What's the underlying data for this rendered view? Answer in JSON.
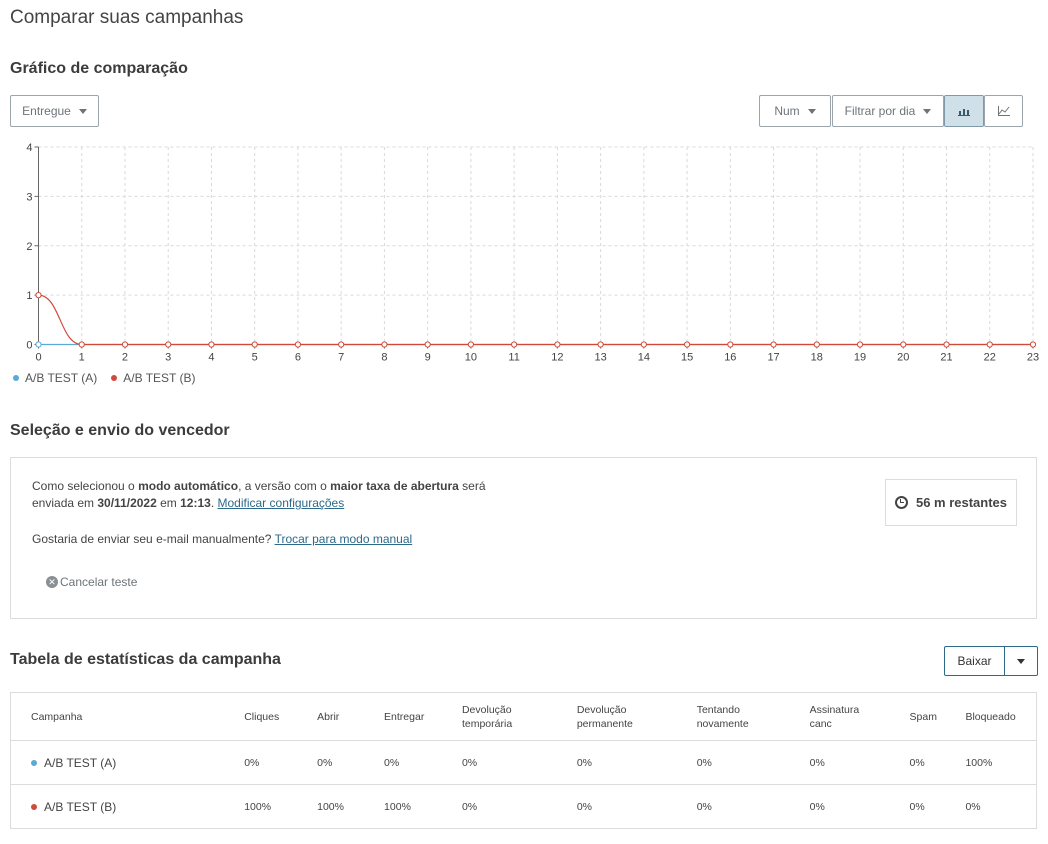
{
  "page": {
    "title": "Comparar suas campanhas"
  },
  "chart_section": {
    "title": "Gráfico de comparação",
    "metric_dropdown": "Entregue",
    "num_dropdown": "Num",
    "filter_dropdown": "Filtrar por dia",
    "view_buttons": [
      {
        "icon": "bar-chart-icon",
        "active": true
      },
      {
        "icon": "line-chart-icon",
        "active": false
      }
    ]
  },
  "chart_data": {
    "type": "line",
    "x": [
      0,
      1,
      2,
      3,
      4,
      5,
      6,
      7,
      8,
      9,
      10,
      11,
      12,
      13,
      14,
      15,
      16,
      17,
      18,
      19,
      20,
      21,
      22,
      23
    ],
    "x_tick_labels": [
      "0",
      "1",
      "2",
      "3",
      "4",
      "5",
      "6",
      "7",
      "8",
      "9",
      "10",
      "11",
      "12",
      "13",
      "14",
      "15",
      "16",
      "17",
      "18",
      "19",
      "20",
      "21",
      "22",
      "23"
    ],
    "y_tick_labels": [
      "0",
      "1",
      "2",
      "3",
      "4"
    ],
    "ylim": [
      0,
      4
    ],
    "grid": true,
    "legend": "bottom-left",
    "series": [
      {
        "name": "A/B TEST (A)",
        "color": "#5aa9d6",
        "values": [
          0,
          0,
          0,
          0,
          0,
          0,
          0,
          0,
          0,
          0,
          0,
          0,
          0,
          0,
          0,
          0,
          0,
          0,
          0,
          0,
          0,
          0,
          0,
          0
        ]
      },
      {
        "name": "A/B TEST (B)",
        "color": "#d04a3a",
        "values": [
          1,
          0,
          0,
          0,
          0,
          0,
          0,
          0,
          0,
          0,
          0,
          0,
          0,
          0,
          0,
          0,
          0,
          0,
          0,
          0,
          0,
          0,
          0,
          0
        ]
      }
    ]
  },
  "winner_section": {
    "title": "Seleção e envio do vencedor",
    "text_1": "Como selecionou o ",
    "text_bold_1": "modo automático",
    "text_2": ", a versão com o ",
    "text_bold_2": "maior taxa de abertura",
    "text_3": " será enviada em ",
    "text_bold_3": "30/11/2022",
    "text_4": " em ",
    "text_bold_4": "12:13",
    "text_5": ". ",
    "modify_link": "Modificar configurações",
    "manual_text": "Gostaria de enviar seu e-mail manualmente? ",
    "manual_link": "Trocar para modo manual",
    "cancel_label": "Cancelar teste",
    "timer_label": "56 m restantes"
  },
  "stats_section": {
    "title": "Tabela de estatísticas da campanha",
    "download_label": "Baixar",
    "columns": [
      [
        "Campanha"
      ],
      [
        "Cliques"
      ],
      [
        "Abrir"
      ],
      [
        "Entregar"
      ],
      [
        "Devolução",
        "temporária"
      ],
      [
        "Devolução",
        "permanente"
      ],
      [
        "Tentando",
        "novamente"
      ],
      [
        "Assinatura",
        "canc"
      ],
      [
        "Spam"
      ],
      [
        "Bloqueado"
      ]
    ],
    "rows": [
      {
        "name": "A/B TEST (A)",
        "color": "#5aa9d6",
        "values": [
          "0%",
          "0%",
          "0%",
          "0%",
          "0%",
          "0%",
          "0%",
          "0%",
          "100%"
        ]
      },
      {
        "name": "A/B TEST (B)",
        "color": "#d04a3a",
        "values": [
          "100%",
          "100%",
          "100%",
          "0%",
          "0%",
          "0%",
          "0%",
          "0%",
          "0%"
        ]
      }
    ]
  }
}
